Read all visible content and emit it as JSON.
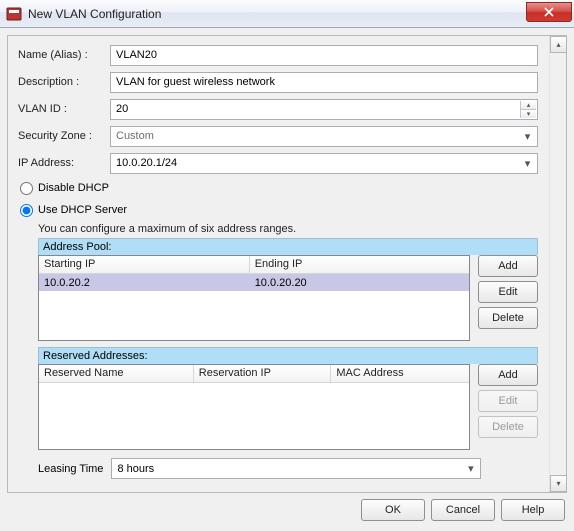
{
  "window": {
    "title": "New VLAN Configuration",
    "close_symbol": "✕"
  },
  "form": {
    "name_label": "Name (Alias) :",
    "name_value": "VLAN20",
    "description_label": "Description :",
    "description_value": "VLAN for guest wireless network",
    "vlanid_label": "VLAN ID :",
    "vlanid_value": "20",
    "securityzone_label": "Security Zone :",
    "securityzone_value": "Custom",
    "ipaddress_label": "IP Address:",
    "ipaddress_value": "10.0.20.1/24"
  },
  "dhcp": {
    "disable_label": "Disable DHCP",
    "use_label": "Use DHCP Server",
    "hint": "You can configure a maximum of six address ranges."
  },
  "address_pool": {
    "header": "Address Pool:",
    "columns": {
      "start": "Starting IP",
      "end": "Ending IP"
    },
    "rows": [
      {
        "start": "10.0.20.2",
        "end": "10.0.20.20"
      }
    ],
    "buttons": {
      "add": "Add",
      "edit": "Edit",
      "delete": "Delete"
    }
  },
  "reserved": {
    "header": "Reserved Addresses:",
    "columns": {
      "name": "Reserved Name",
      "ip": "Reservation IP",
      "mac": "MAC Address"
    },
    "buttons": {
      "add": "Add",
      "edit": "Edit",
      "delete": "Delete"
    }
  },
  "leasing": {
    "label": "Leasing Time",
    "value": "8 hours"
  },
  "footer": {
    "ok": "OK",
    "cancel": "Cancel",
    "help": "Help"
  }
}
